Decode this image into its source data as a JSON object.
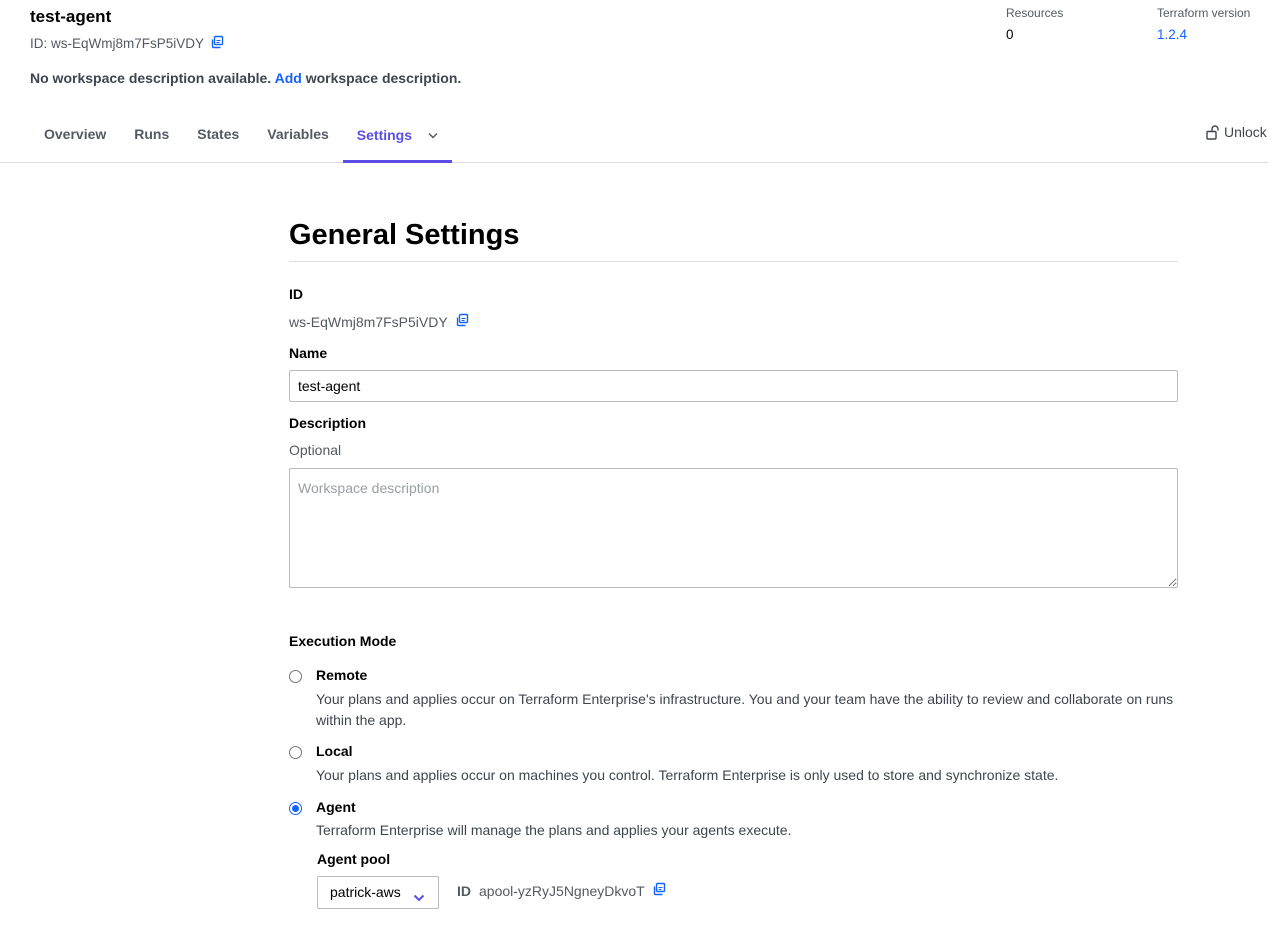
{
  "workspace": {
    "name": "test-agent",
    "id_line": "ID: ws-EqWmj8m7FsP5iVDY",
    "desc_prefix": "No workspace description available.",
    "desc_link": "Add",
    "desc_suffix": "workspace description."
  },
  "meta": {
    "resources_label": "Resources",
    "resources_value": "0",
    "tf_label": "Terraform version",
    "tf_value": "1.2.4"
  },
  "tabs": [
    {
      "label": "Overview"
    },
    {
      "label": "Runs"
    },
    {
      "label": "States"
    },
    {
      "label": "Variables"
    },
    {
      "label": "Settings"
    }
  ],
  "unlock_label": "Unlock",
  "settings": {
    "title": "General Settings",
    "id_label": "ID",
    "id_value": "ws-EqWmj8m7FsP5iVDY",
    "name_label": "Name",
    "name_value": "test-agent",
    "description_label": "Description",
    "description_optional": "Optional",
    "description_placeholder": "Workspace description",
    "execution_mode_label": "Execution Mode",
    "modes": [
      {
        "label": "Remote",
        "help": "Your plans and applies occur on Terraform Enterprise's infrastructure. You and your team have the ability to review and collaborate on runs within the app.",
        "selected": false
      },
      {
        "label": "Local",
        "help": "Your plans and applies occur on machines you control. Terraform Enterprise is only used to store and synchronize state.",
        "selected": false
      },
      {
        "label": "Agent",
        "help": "Terraform Enterprise will manage the plans and applies your agents execute.",
        "selected": true
      }
    ],
    "agent_pool_label": "Agent pool",
    "agent_pool_value": "patrick-aws",
    "agent_pool_id_key": "ID",
    "agent_pool_id_value": "apool-yzRyJ5NgneyDkvoT"
  },
  "colors": {
    "accent": "#5c4ee5",
    "link": "#1563ff"
  }
}
